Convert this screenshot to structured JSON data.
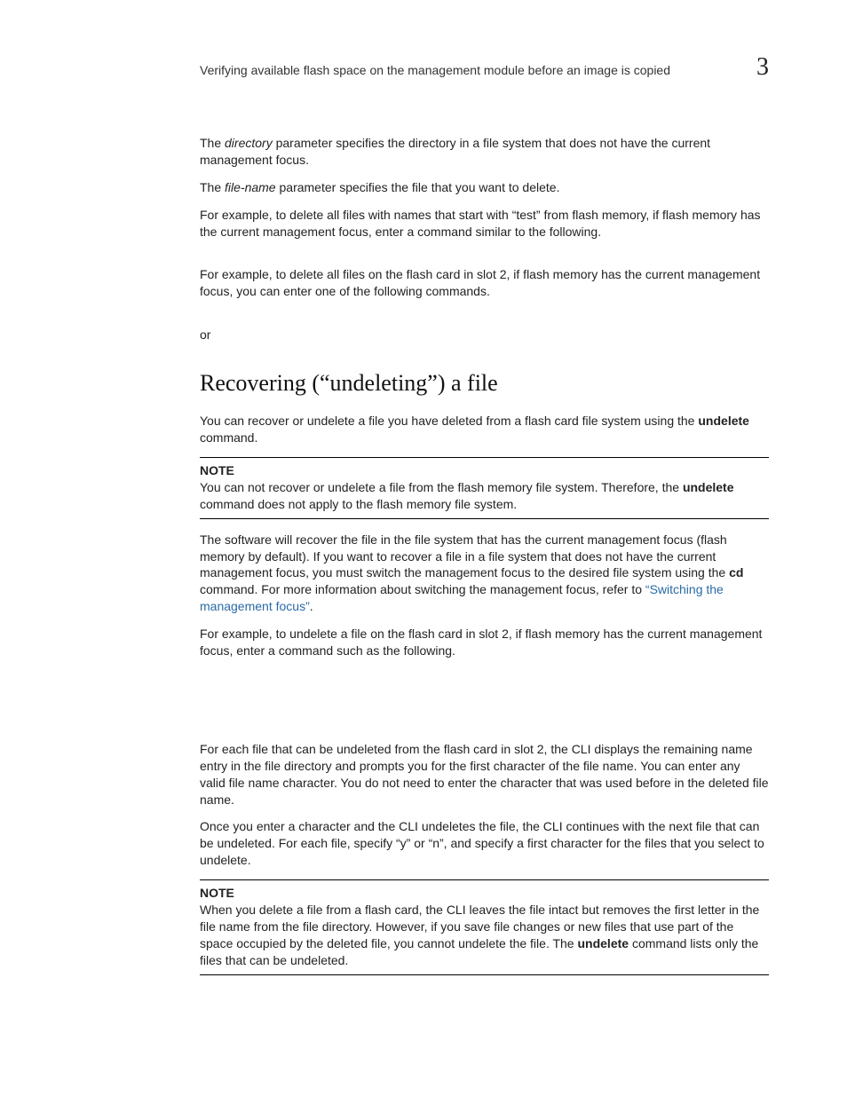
{
  "header": {
    "running_title": "Verifying available flash space on the management  module before an image is copied",
    "chapter_number": "3"
  },
  "intro": {
    "p1_a": "The ",
    "p1_em": "directory",
    "p1_b": " parameter specifies the directory in a file system that does not have the current management focus.",
    "p2_a": "The ",
    "p2_em": "file-name",
    "p2_b": " parameter specifies the file that you want to delete.",
    "p3": "For example, to delete all files with names that start with “test” from flash memory, if flash memory has the current management focus, enter a command similar to the following.",
    "p4": "For example, to delete all files on the flash card in slot 2, if flash memory has the current management focus, you can enter one of the following commands.",
    "or": "or"
  },
  "section": {
    "title": "Recovering (“undeleting”) a file",
    "p1_a": "You can recover or undelete a file you have deleted from a flash card file system using the ",
    "p1_b": "undelete",
    "p1_c": " command.",
    "note1_label": "NOTE",
    "note1_a": "You can not recover or undelete a file from the flash memory file system. Therefore, the ",
    "note1_b": "undelete",
    "note1_c": " command does not apply to the flash memory file system.",
    "p2_a": "The software will recover the file in the file system that has the current management focus (flash memory by default). If you want to recover a file in a file system that does not have the current management focus, you must switch the management focus to the desired file system using the ",
    "p2_b": "cd",
    "p2_c": " command. For more information about switching the management focus, refer to ",
    "p2_link": "“Switching the management focus”",
    "p2_d": ".",
    "p3": "For example, to undelete a file on the flash card in slot 2, if flash memory has the current management focus, enter a command such as the following.",
    "p4": "For each file that can be undeleted from the flash card in slot 2, the CLI displays the remaining name entry in the file directory and prompts you for the first character of the file name. You can enter any valid file name character. You do not need to enter the character that was used before in the deleted file name.",
    "p5": "Once you enter a character and the CLI undeletes the file, the CLI continues with the next file that can be undeleted. For each file, specify “y” or “n”, and specify a first character for the files that you select to undelete.",
    "note2_label": "NOTE",
    "note2_a": "When you delete a file from a flash card, the CLI leaves the file intact but removes the first letter in the file name from the file directory. However, if you save file changes or new files that use part of the space occupied by the deleted file, you cannot undelete the file. The ",
    "note2_b": "undelete",
    "note2_c": " command lists only the files that can be undeleted."
  }
}
